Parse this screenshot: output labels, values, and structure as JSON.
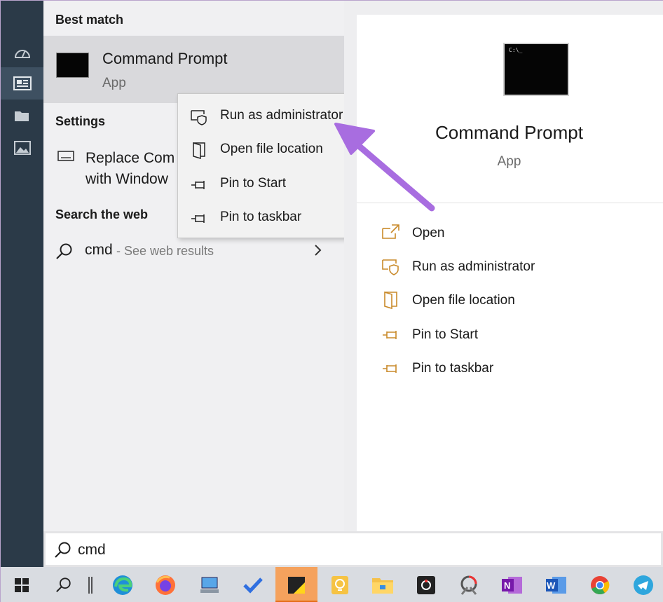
{
  "best_match": {
    "header": "Best match",
    "title": "Command Prompt",
    "subtitle": "App"
  },
  "settings": {
    "header": "Settings",
    "item_line1": "Replace Com",
    "item_line2": "with Window"
  },
  "web": {
    "header": "Search the web",
    "query": "cmd",
    "hint": "- See web results"
  },
  "context_menu": {
    "items": [
      {
        "label": "Run as administrator",
        "icon": "shield-icon"
      },
      {
        "label": "Open file location",
        "icon": "folder-location-icon"
      },
      {
        "label": "Pin to Start",
        "icon": "pin-icon"
      },
      {
        "label": "Pin to taskbar",
        "icon": "pin-icon"
      }
    ]
  },
  "preview": {
    "title": "Command Prompt",
    "subtitle": "App",
    "actions": [
      {
        "label": "Open",
        "icon": "open-icon"
      },
      {
        "label": "Run as administrator",
        "icon": "shield-icon"
      },
      {
        "label": "Open file location",
        "icon": "folder-location-icon"
      },
      {
        "label": "Pin to Start",
        "icon": "pin-icon"
      },
      {
        "label": "Pin to taskbar",
        "icon": "pin-icon"
      }
    ]
  },
  "search": {
    "value": "cmd"
  },
  "colors": {
    "accent": "#c98a2a",
    "annotation_arrow": "#a86de0",
    "rail": "#2b3a48",
    "taskbar_active": "#f5a25d"
  }
}
